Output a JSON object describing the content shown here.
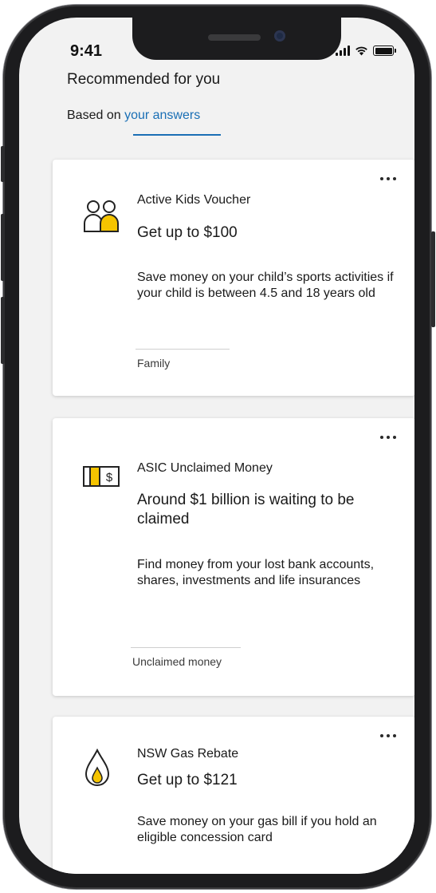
{
  "status_bar": {
    "time": "9:41"
  },
  "page": {
    "title": "Recommended for you",
    "subtitle_prefix": "Based on ",
    "subtitle_link": "your answers"
  },
  "cards": [
    {
      "name": "Active Kids Voucher",
      "headline": "Get up to $100",
      "description": "Save money on your child’s sports activities if your child is between 4.5 and 18 years old",
      "tag": "Family",
      "icon": "family-icon"
    },
    {
      "name": "ASIC Unclaimed Money",
      "headline": "Around $1 billion is waiting to be claimed",
      "description": "Find money from your lost bank accounts, shares, investments and life insurances",
      "tag": "Unclaimed money",
      "icon": "money-icon"
    },
    {
      "name": "NSW Gas Rebate",
      "headline": "Get up to $121",
      "description": "Save money on your gas bill if you hold an eligible concession card",
      "tag": "",
      "icon": "gas-flame-icon"
    }
  ],
  "colors": {
    "accent": "#1a6fb5",
    "icon_fill": "#f5c400",
    "background": "#f2f2f2"
  }
}
